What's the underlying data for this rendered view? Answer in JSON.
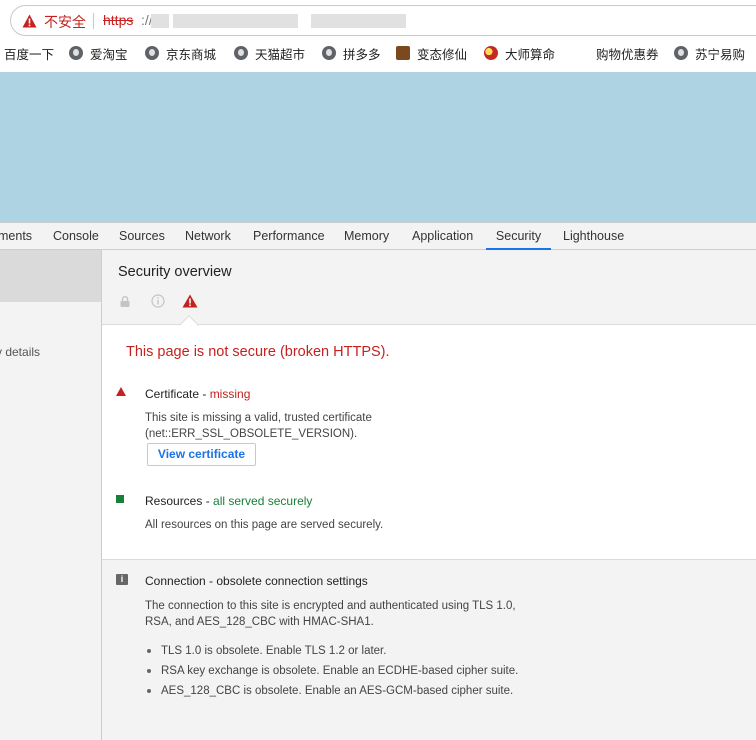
{
  "address_bar": {
    "security_label": "不安全",
    "scheme": "https",
    "scheme_rest": "://"
  },
  "bookmarks": [
    {
      "label": "百度一下",
      "icon": "none"
    },
    {
      "label": "爱淘宝",
      "icon": "globe-icon"
    },
    {
      "label": "京东商城",
      "icon": "globe-icon"
    },
    {
      "label": "天猫超市",
      "icon": "globe-icon"
    },
    {
      "label": "拼多多",
      "icon": "globe-icon"
    },
    {
      "label": "变态修仙",
      "icon": "avatar-icon"
    },
    {
      "label": "大师算命",
      "icon": "yin-yang-icon"
    },
    {
      "label": "购物优惠券",
      "icon": "none"
    },
    {
      "label": "苏宁易购",
      "icon": "globe-icon"
    }
  ],
  "devtools": {
    "tabs": [
      {
        "label": "ments",
        "active": false
      },
      {
        "label": "Console",
        "active": false
      },
      {
        "label": "Sources",
        "active": false
      },
      {
        "label": "Network",
        "active": false
      },
      {
        "label": "Performance",
        "active": false
      },
      {
        "label": "Memory",
        "active": false
      },
      {
        "label": "Application",
        "active": false
      },
      {
        "label": "Security",
        "active": true
      },
      {
        "label": "Lighthouse",
        "active": false
      }
    ],
    "sidebar": {
      "view_details": "v details"
    }
  },
  "security": {
    "overview_title": "Security overview",
    "summary": "This page is not secure (broken HTTPS).",
    "certificate": {
      "title": "Certificate - ",
      "status": "missing",
      "desc_line1": "This site is missing a valid, trusted certificate",
      "desc_line2": "(net::ERR_SSL_OBSOLETE_VERSION).",
      "button": "View certificate"
    },
    "resources": {
      "title": "Resources - ",
      "status": "all served securely",
      "desc": "All resources on this page are served securely."
    },
    "connection": {
      "title": "Connection - obsolete connection settings",
      "desc_line1": "The connection to this site is encrypted and authenticated using TLS 1.0,",
      "desc_line2": "RSA, and AES_128_CBC with HMAC-SHA1.",
      "items": [
        "TLS 1.0 is obsolete. Enable TLS 1.2 or later.",
        "RSA key exchange is obsolete. Enable an ECDHE-based cipher suite.",
        "AES_128_CBC is obsolete. Enable an AES-GCM-based cipher suite."
      ]
    }
  },
  "colors": {
    "insecure_red": "#c5221f",
    "secure_green": "#188038",
    "accent_blue": "#1a73e8",
    "viewport_bg": "#aed3e3"
  }
}
